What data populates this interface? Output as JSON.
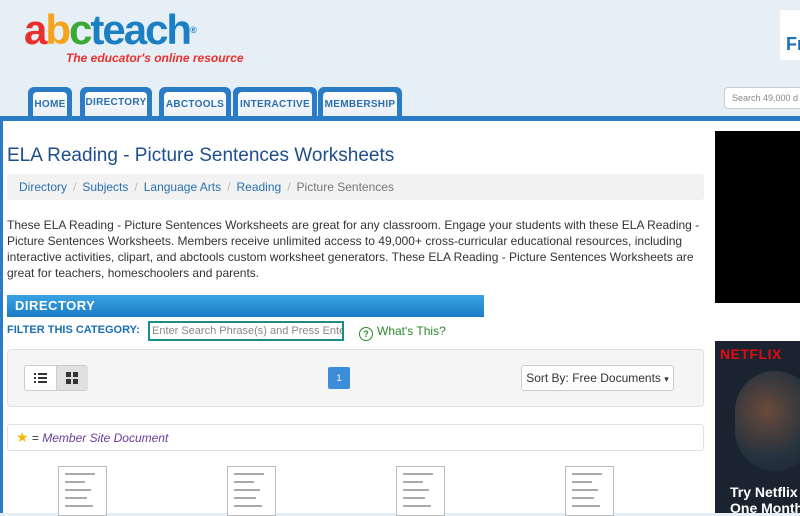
{
  "header": {
    "logo_parts": [
      "a",
      "b",
      "c",
      "teach"
    ],
    "logo_mark": "®",
    "tagline": "The educator's online resource",
    "topright_text": "Fr",
    "search_placeholder": "Search 49,000 d"
  },
  "nav": {
    "tabs": [
      {
        "label": "HOME",
        "active": false
      },
      {
        "label": "DIRECTORY",
        "active": true
      },
      {
        "label": "ABCTOOLS",
        "active": false
      },
      {
        "label": "INTERACTIVE",
        "active": false
      },
      {
        "label": "MEMBERSHIP",
        "active": false
      }
    ]
  },
  "page": {
    "title": "ELA Reading - Picture Sentences Worksheets",
    "breadcrumbs": [
      "Directory",
      "Subjects",
      "Language Arts",
      "Reading"
    ],
    "breadcrumb_current": "Picture Sentences",
    "breadcrumb_sep": "/",
    "description": "These ELA Reading - Picture Sentences Worksheets are great for any classroom. Engage your students with these ELA Reading - Picture Sentences Worksheets. Members receive unlimited access to 49,000+ cross-curricular educational resources, including interactive activities, clipart, and abctools custom worksheet generators. These ELA Reading - Picture Sentences Worksheets are great for teachers, homeschoolers and parents."
  },
  "directory": {
    "heading": "DIRECTORY",
    "filter_label": "FILTER THIS CATEGORY:",
    "filter_placeholder": "Enter Search Phrase(s) and Press Enter",
    "help_icon_glyph": "?",
    "whats_this": "What's This?"
  },
  "toolbar": {
    "view_list_icon": "list-icon",
    "view_grid_icon": "grid-icon",
    "current_page": "1",
    "sort_label": "Sort By: Free Documents",
    "sort_caret": "▾"
  },
  "legend": {
    "star_glyph": "★",
    "equals": "=",
    "text": "Member Site Document"
  },
  "ads": {
    "netflix_brand": "NETFLIX",
    "netflix_cta": "Try Netflix",
    "netflix_cta2": "One Month"
  },
  "colors": {
    "accent_blue": "#2a7cc7",
    "title_blue": "#1f4e8c",
    "link_blue": "#2a6fb0",
    "member_purple": "#6b3a9c",
    "netflix_red": "#e50914"
  }
}
